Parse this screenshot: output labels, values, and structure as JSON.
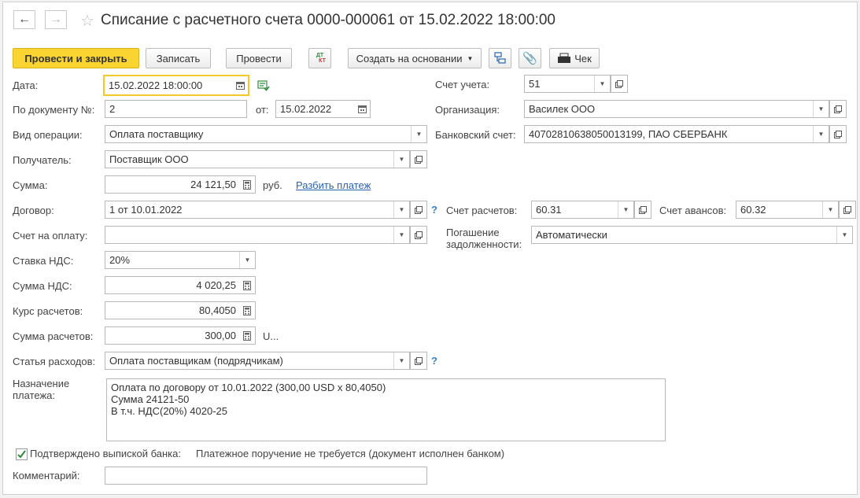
{
  "window": {
    "title": "Списание с расчетного счета 0000-000061 от 15.02.2022 18:00:00"
  },
  "toolbar": {
    "post_close": "Провести и закрыть",
    "save": "Записать",
    "post": "Провести",
    "dt_kt_top": "ДТ",
    "dt_kt_bottom": "КТ",
    "create_based": "Создать на основании",
    "check": "Чек"
  },
  "fields": {
    "date": {
      "label": "Дата:",
      "value": "15.02.2022 18:00:00"
    },
    "doc_num": {
      "label": "По документу №:",
      "value": "2"
    },
    "doc_from": {
      "label": "от:",
      "value": "15.02.2022"
    },
    "operation": {
      "label": "Вид операции:",
      "value": "Оплата поставщику"
    },
    "recipient": {
      "label": "Получатель:",
      "value": "Поставщик ООО"
    },
    "amount": {
      "label": "Сумма:",
      "value": "24 121,50",
      "currency": "руб.",
      "split_link": "Разбить платеж"
    },
    "contract": {
      "label": "Договор:",
      "value": "1 от 10.01.2022"
    },
    "invoice": {
      "label": "Счет на оплату:",
      "value": ""
    },
    "vat_rate": {
      "label": "Ставка НДС:",
      "value": "20%"
    },
    "vat_amount": {
      "label": "Сумма НДС:",
      "value": "4 020,25"
    },
    "rate": {
      "label": "Курс расчетов:",
      "value": "80,4050"
    },
    "settle_amount": {
      "label": "Сумма расчетов:",
      "value": "300,00",
      "currency": "U..."
    },
    "expense": {
      "label": "Статья расходов:",
      "value": "Оплата поставщикам (подрядчикам)"
    },
    "purpose": {
      "label_line1": "Назначение",
      "label_line2": "платежа:",
      "value": "Оплата по договору от 10.01.2022 (300,00 USD x 80,4050)\nСумма 24121-50\nВ т.ч. НДС(20%) 4020-25"
    },
    "confirmed": {
      "label": "Подтверждено выпиской банка:",
      "note": "Платежное поручение не требуется (документ исполнен банком)"
    },
    "comment": {
      "label": "Комментарий:",
      "value": ""
    },
    "account": {
      "label": "Счет учета:",
      "value": "51"
    },
    "organization": {
      "label": "Организация:",
      "value": "Василек ООО"
    },
    "bank_account": {
      "label": "Банковский счет:",
      "value": "40702810638050013199, ПАО СБЕРБАНК"
    },
    "settle_account": {
      "label": "Счет расчетов:",
      "value": "60.31"
    },
    "advance_account": {
      "label": "Счет авансов:",
      "value": "60.32"
    },
    "debt_repay": {
      "label_line1": "Погашение",
      "label_line2": "задолженности:",
      "value": "Автоматически"
    }
  },
  "colors": {
    "primary_button": "#fad532",
    "focus_border": "#f5c82a",
    "link": "#2a63b0",
    "help": "#3a83c7",
    "check": "#2e8b3a"
  }
}
